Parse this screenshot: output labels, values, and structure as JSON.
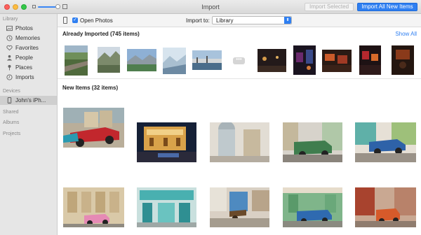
{
  "window": {
    "title": "Import"
  },
  "buttons": {
    "import_selected": "Import Selected",
    "import_all": "Import All New Items"
  },
  "sidebar": {
    "sections": {
      "library": "Library",
      "devices": "Devices",
      "shared": "Shared",
      "albums": "Albums",
      "projects": "Projects"
    },
    "library_items": [
      {
        "label": "Photos",
        "icon": "photos-icon"
      },
      {
        "label": "Memories",
        "icon": "memories-icon"
      },
      {
        "label": "Favorites",
        "icon": "heart-icon"
      },
      {
        "label": "People",
        "icon": "person-icon"
      },
      {
        "label": "Places",
        "icon": "pin-icon"
      },
      {
        "label": "Imports",
        "icon": "clock-icon"
      }
    ],
    "device": {
      "label": "John's iPh...",
      "icon": "iphone-icon"
    }
  },
  "toolbar": {
    "open_photos_label": "Open Photos",
    "open_photos_checked": true,
    "import_to_label": "Import to:",
    "import_to_value": "Library"
  },
  "already_imported": {
    "title": "Already Imported (745 items)",
    "show_all": "Show All"
  },
  "new_items": {
    "title": "New Items (32 items)"
  },
  "colors": {
    "accent": "#2f7ff1",
    "sidebar_bg": "#e6e6e6",
    "selected_bg": "#cfcfcf"
  }
}
